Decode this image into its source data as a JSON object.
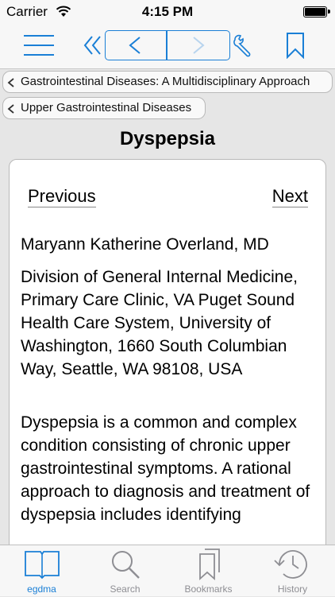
{
  "status_bar": {
    "carrier": "Carrier",
    "time": "4:15 PM"
  },
  "toolbar": {
    "icons": [
      "menu-icon",
      "first-page-icon",
      "back-icon",
      "forward-icon",
      "wrench-icon",
      "bookmark-icon"
    ]
  },
  "breadcrumbs": [
    {
      "label": "Gastrointestinal Diseases: A Multidisciplinary Approach"
    },
    {
      "label": "Upper Gastrointestinal Diseases"
    }
  ],
  "page": {
    "title": "Dyspepsia"
  },
  "content": {
    "previous_label": "Previous",
    "next_label": "Next",
    "author": "Maryann Katherine Overland, MD",
    "affiliation": "Division of General Internal Medicine, Primary Care Clinic, VA Puget Sound Health Care System, University of Washington, 1660 South Columbian Way, Seattle, WA 98108, USA",
    "abstract": "Dyspepsia is a common and complex condition consisting of chronic upper gastrointestinal symptoms. A rational approach to diagnosis and treatment of dyspepsia includes identifying"
  },
  "tabbar": {
    "tabs": [
      {
        "label": "egdma",
        "icon": "book-icon",
        "active": true
      },
      {
        "label": "Search",
        "icon": "search-icon",
        "active": false
      },
      {
        "label": "Bookmarks",
        "icon": "bookmarks-icon",
        "active": false
      },
      {
        "label": "History",
        "icon": "history-icon",
        "active": false
      }
    ]
  },
  "colors": {
    "accent": "#1a7fd6",
    "inactive": "#8e8e93",
    "background": "#e6e6e6"
  }
}
